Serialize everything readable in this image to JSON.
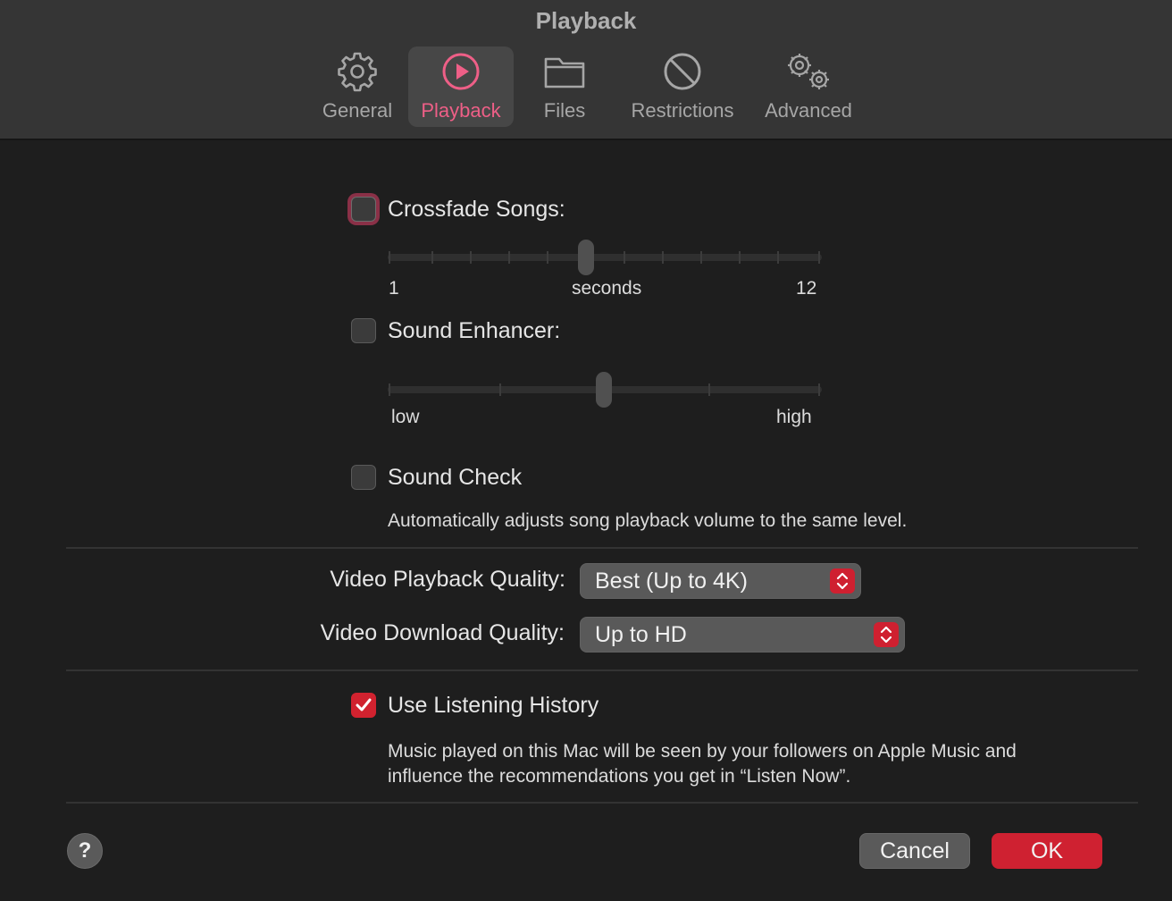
{
  "window": {
    "title": "Playback"
  },
  "tabs": [
    {
      "label": "General",
      "icon": "gear-icon"
    },
    {
      "label": "Playback",
      "icon": "play-circle-icon",
      "active": true
    },
    {
      "label": "Files",
      "icon": "folder-icon"
    },
    {
      "label": "Restrictions",
      "icon": "prohibited-icon"
    },
    {
      "label": "Advanced",
      "icon": "gears-icon"
    }
  ],
  "crossfade": {
    "label": "Crossfade Songs:",
    "checked": false,
    "slider": {
      "min_label": "1",
      "unit_label": "seconds",
      "max_label": "12",
      "min": 1,
      "max": 12,
      "value": 6
    }
  },
  "sound_enhancer": {
    "label": "Sound Enhancer:",
    "checked": false,
    "slider": {
      "min_label": "low",
      "max_label": "high",
      "value": 0.5
    }
  },
  "sound_check": {
    "label": "Sound Check",
    "checked": false,
    "description": "Automatically adjusts song playback volume to the same level."
  },
  "video_playback": {
    "label": "Video Playback Quality:",
    "value": "Best (Up to 4K)"
  },
  "video_download": {
    "label": "Video Download Quality:",
    "value": "Up to HD"
  },
  "listening_history": {
    "label": "Use Listening History",
    "checked": true,
    "description_line1": "Music played on this Mac will be seen by your followers on Apple Music and",
    "description_line2": "influence the recommendations you get in “Listen Now”."
  },
  "footer": {
    "help_label": "?",
    "cancel_label": "Cancel",
    "ok_label": "OK"
  },
  "colors": {
    "accent": "#cf2131",
    "active_tab": "#ee5f87"
  }
}
